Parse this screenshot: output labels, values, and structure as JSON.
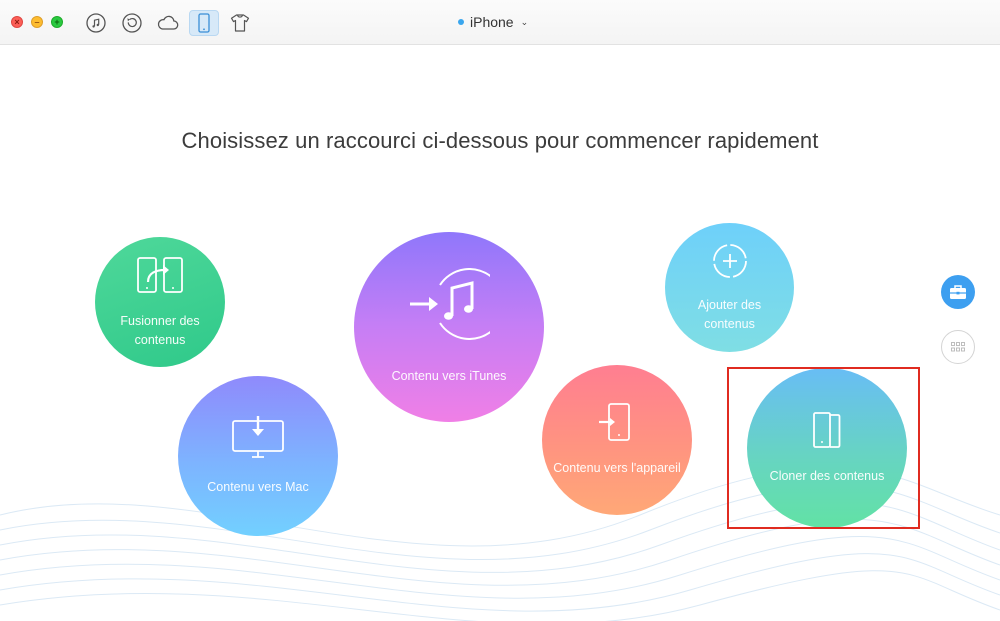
{
  "toolbar": {
    "window_controls": [
      "close",
      "minimize",
      "zoom"
    ],
    "icons": [
      "music-note-icon",
      "backup-restore-icon",
      "icloud-icon",
      "iphone-icon",
      "tshirt-icon"
    ],
    "active_icon": "iphone-icon",
    "device": {
      "name": "iPhone",
      "chevron": "⌄",
      "status_color": "#3aa6ee"
    }
  },
  "main": {
    "headline": "Choisissez un raccourci ci-dessous pour commencer rapidement",
    "shortcuts": {
      "merge": {
        "label": "Fusionner des contenus",
        "icon": "merge-icon"
      },
      "mac": {
        "label": "Contenu vers Mac",
        "icon": "monitor-download-icon"
      },
      "itunes": {
        "label": "Contenu vers iTunes",
        "icon": "itunes-icon"
      },
      "device": {
        "label": "Contenu vers l'appareil",
        "icon": "phone-import-icon"
      },
      "add": {
        "label": "Ajouter des contenus",
        "icon": "add-circle-icon"
      },
      "clone": {
        "label": "Cloner des contenus",
        "icon": "clone-phones-icon"
      }
    },
    "highlighted_shortcut": "clone",
    "highlight_color": "#e02b20",
    "sidebar": {
      "tools_icon": "toolbox-icon",
      "apps_icon": "grid-icon",
      "tools_color": "#3d9ff0"
    }
  }
}
